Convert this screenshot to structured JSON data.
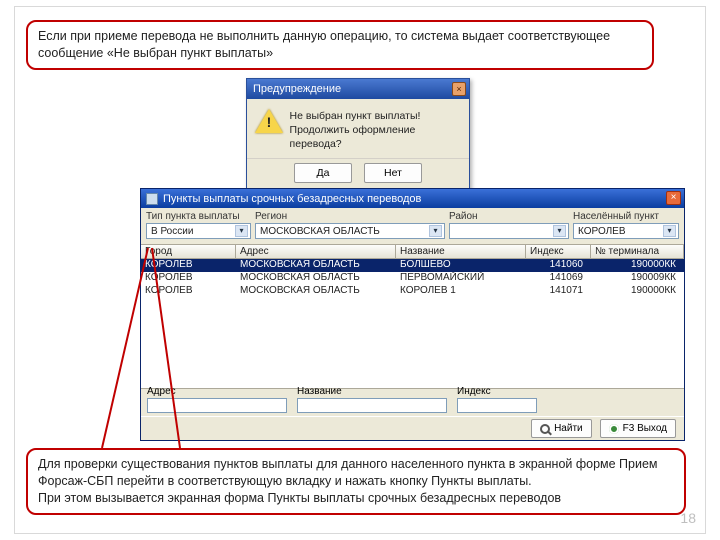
{
  "page_number": "18",
  "callouts": {
    "top": "Если при приеме перевода не выполнить данную операцию, то система выдает соответствующее сообщение «Не выбран пункт выплаты»",
    "bottom": "Для проверки существования пунктов выплаты для данного населенного пункта в экранной форме Прием Форсаж-СБП перейти в соответствующую вкладку и нажать кнопку Пункты выплаты.\nПри этом вызывается экранная форма Пункты выплаты срочных безадресных переводов"
  },
  "warning_dialog": {
    "title": "Предупреждение",
    "line1": "Не выбран пункт выплаты!",
    "line2": "Продолжить оформление перевода?",
    "yes": "Да",
    "no": "Нет"
  },
  "main_window": {
    "title": "Пункты выплаты срочных безадресных переводов",
    "filters": {
      "type_label": "Тип пункта выплаты",
      "type_value": "В России",
      "region_label": "Регион",
      "region_value": "МОСКОВСКАЯ ОБЛАСТЬ",
      "district_label": "Район",
      "district_value": "",
      "locality_label": "Населённый пункт",
      "locality_value": "КОРОЛЕВ"
    },
    "columns": {
      "city": "Город",
      "address": "Адрес",
      "name": "Название",
      "index": "Индекс",
      "terminal": "№ терминала"
    },
    "rows": [
      {
        "city": "КОРОЛЕВ",
        "address": "МОСКОВСКАЯ ОБЛАСТЬ",
        "name": "БОЛШЕВО",
        "index": "141060",
        "terminal": "190000КК"
      },
      {
        "city": "КОРОЛЕВ",
        "address": "МОСКОВСКАЯ ОБЛАСТЬ",
        "name": "ПЕРВОМАЙСКИЙ",
        "index": "141069",
        "terminal": "190009КК"
      },
      {
        "city": "КОРОЛЕВ",
        "address": "МОСКОВСКАЯ ОБЛАСТЬ",
        "name": "КОРОЛЕВ 1",
        "index": "141071",
        "terminal": "190000КК"
      }
    ],
    "search": {
      "address_label": "Адрес",
      "name_label": "Название",
      "index_label": "Индекс"
    },
    "buttons": {
      "find": "Найти",
      "exit": "F3 Выход"
    }
  }
}
